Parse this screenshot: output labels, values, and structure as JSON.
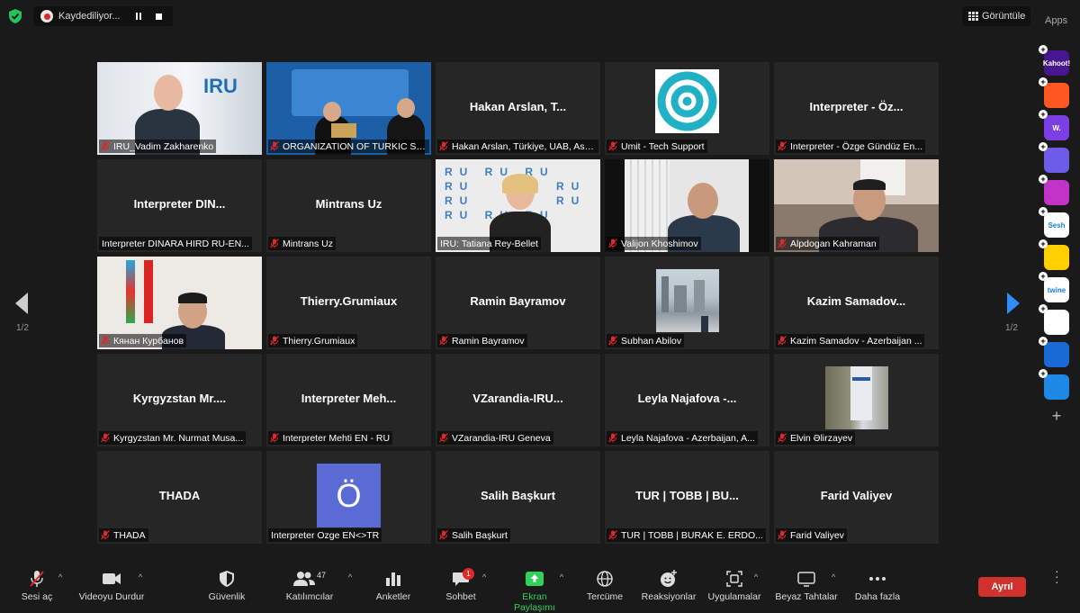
{
  "topbar": {
    "recording_label": "Kaydediliyor...",
    "view_label": "Görüntüle",
    "apps_label": "Apps"
  },
  "tiles": [
    {
      "label": "IRU_Vadim Zakharenko",
      "type": "video",
      "muted": true
    },
    {
      "label": "ORGANIZATION OF TURKIC STATES",
      "type": "video",
      "muted": true
    },
    {
      "big": "Hakan Arslan, T...",
      "label": "Hakan Arslan, Türkiye, UAB, Asst...",
      "type": "name",
      "muted": true
    },
    {
      "label": "Umit - Tech Support",
      "type": "logo",
      "muted": true
    },
    {
      "big": "Interpreter - Öz...",
      "label": "Interpreter - Özge Gündüz En...",
      "type": "name",
      "muted": true
    },
    {
      "big": "Interpreter DIN...",
      "label": "Interpreter DINARA HIRD RU-EN...",
      "type": "name",
      "muted": false
    },
    {
      "big": "Mintrans Uz",
      "label": "Mintrans Uz",
      "type": "name",
      "muted": true
    },
    {
      "label": "IRU: Tatiana Rey-Bellet",
      "type": "video",
      "muted": false,
      "active": true
    },
    {
      "label": "Valijon Khoshimov",
      "type": "video",
      "muted": true
    },
    {
      "label": "Alpdogan Kahraman",
      "type": "video",
      "muted": true
    },
    {
      "label": "Кянан Курбанов",
      "type": "video",
      "muted": true
    },
    {
      "big": "Thierry.Grumiaux",
      "label": "Thierry.Grumiaux",
      "type": "name",
      "muted": true
    },
    {
      "big": "Ramin Bayramov",
      "label": "Ramin Bayramov",
      "type": "name",
      "muted": true
    },
    {
      "label": "Subhan Abilov",
      "type": "photo",
      "muted": true
    },
    {
      "big": "Kazim Samadov...",
      "label": "Kazim Samadov - Azerbaijan ...",
      "type": "name",
      "muted": true
    },
    {
      "big": "Kyrgyzstan Mr....",
      "label": "Kyrgyzstan Mr. Nurmat Musa...",
      "type": "name",
      "muted": true
    },
    {
      "big": "Interpreter Meh...",
      "label": "Interpreter Mehti EN - RU",
      "type": "name",
      "muted": true
    },
    {
      "big": "VZarandia-IRU...",
      "label": "VZarandia-IRU Geneva",
      "type": "name",
      "muted": true
    },
    {
      "big": "Leyla Najafova -...",
      "label": "Leyla Najafova - Azerbaijan, A...",
      "type": "name",
      "muted": true
    },
    {
      "label": "Elvin Əlirzayev",
      "type": "photo",
      "muted": true
    },
    {
      "big": "THADA",
      "label": "THADA",
      "type": "name",
      "muted": true
    },
    {
      "avatar_letter": "Ö",
      "label": "Interpreter Ozge EN<>TR",
      "type": "avatar",
      "muted": false
    },
    {
      "big": "Salih Başkurt",
      "label": "Salih Başkurt",
      "type": "name",
      "muted": true
    },
    {
      "big": "TUR | TOBB | BU...",
      "label": "TUR | TOBB | BURAK E. ERDO...",
      "type": "name",
      "muted": true
    },
    {
      "big": "Farid Valiyev",
      "label": "Farid Valiyev",
      "type": "name",
      "muted": true
    }
  ],
  "pagination": {
    "left": "1/2",
    "right": "1/2"
  },
  "sidebar_apps": [
    {
      "name": "kahoot-app",
      "text": "Kahoot!",
      "color": "#46178f"
    },
    {
      "name": "app-2",
      "text": "",
      "color": "#ff5722"
    },
    {
      "name": "app-w",
      "text": "W.",
      "color": "#7b3fe4"
    },
    {
      "name": "app-4",
      "text": "",
      "color": "#6d5ce8"
    },
    {
      "name": "app-5",
      "text": "",
      "color": "#c234c8"
    },
    {
      "name": "sesh-app",
      "text": "Sesh",
      "color": "#ffffff"
    },
    {
      "name": "app-7",
      "text": "",
      "color": "#ffd000"
    },
    {
      "name": "twine-app",
      "text": "twine",
      "color": "#ffffff"
    },
    {
      "name": "app-9",
      "text": "",
      "color": "#ffffff"
    },
    {
      "name": "app-10",
      "text": "",
      "color": "#1a6ad6"
    },
    {
      "name": "app-11",
      "text": "",
      "color": "#1e88e5"
    }
  ],
  "toolbar": {
    "mic_label": "Sesi aç",
    "video_label": "Videoyu Durdur",
    "security_label": "Güvenlik",
    "participants_label": "Katılımcılar",
    "participants_count": "47",
    "polls_label": "Anketler",
    "chat_label": "Sohbet",
    "chat_badge": "1",
    "share_label": "Ekran Paylaşımı",
    "translate_label": "Tercüme",
    "reactions_label": "Reaksiyonlar",
    "apps_label": "Uygulamalar",
    "whiteboard_label": "Beyaz Tahtalar",
    "more_label": "Daha fazla",
    "leave_label": "Ayrıl"
  },
  "colors": {
    "active_speaker": "#c8d54b",
    "leave": "#d0312d",
    "share_green": "#2fd35a",
    "muted_red": "#e02828"
  }
}
